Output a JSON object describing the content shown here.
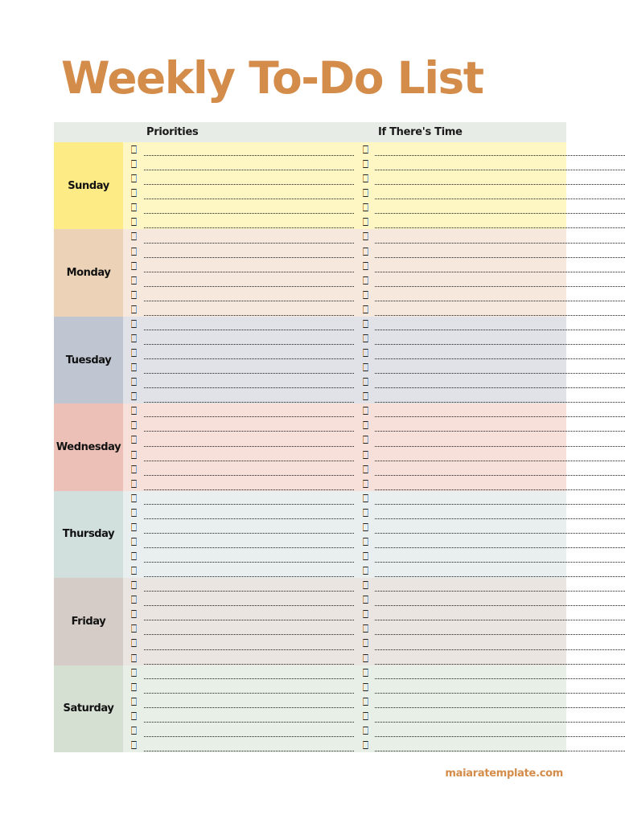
{
  "title": "Weekly To-Do List",
  "columns": {
    "priorities": "Priorities",
    "if_time": "If There's Time"
  },
  "rows_per_day": 6,
  "days": [
    {
      "name": "Sunday",
      "label_color": "#fdeb85",
      "row_color": "#fef6c3"
    },
    {
      "name": "Monday",
      "label_color": "#ecd2b6",
      "row_color": "#f6e8dc"
    },
    {
      "name": "Tuesday",
      "label_color": "#c0c5d2",
      "row_color": "#e0e2e8"
    },
    {
      "name": "Wednesday",
      "label_color": "#ecc0b6",
      "row_color": "#f7dfda"
    },
    {
      "name": "Thursday",
      "label_color": "#d1dfdd",
      "row_color": "#e9efef"
    },
    {
      "name": "Friday",
      "label_color": "#d5ccc7",
      "row_color": "#ebe5e2"
    },
    {
      "name": "Saturday",
      "label_color": "#d5e0d3",
      "row_color": "#e8efe6"
    }
  ],
  "footer": "maiaratemplate.com",
  "colors": {
    "accent": "#d48c4a",
    "header_bg": "#e7ede6"
  }
}
